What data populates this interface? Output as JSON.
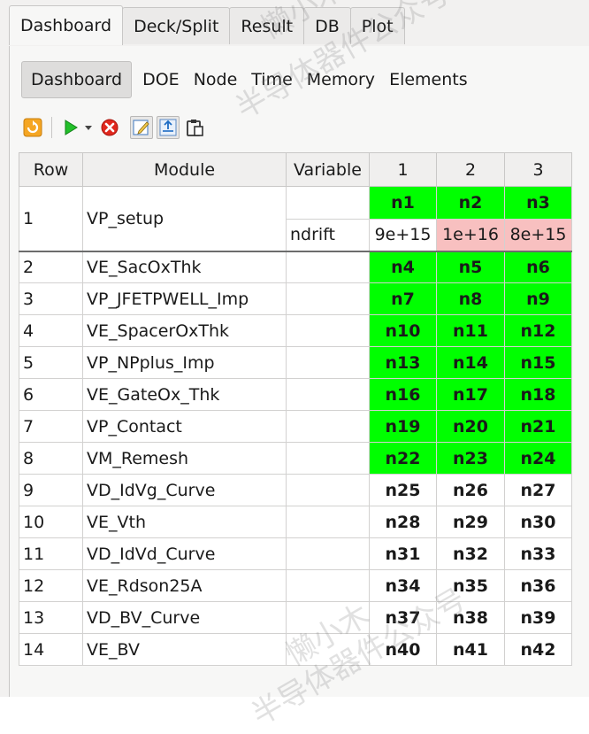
{
  "top_tabs": [
    {
      "label": "Dashboard",
      "active": true
    },
    {
      "label": "Deck/Split",
      "active": false
    },
    {
      "label": "Result",
      "active": false
    },
    {
      "label": "DB",
      "active": false
    },
    {
      "label": "Plot",
      "active": false
    }
  ],
  "sub_tabs": [
    {
      "label": "Dashboard",
      "active": true
    },
    {
      "label": "DOE"
    },
    {
      "label": "Node"
    },
    {
      "label": "Time"
    },
    {
      "label": "Memory"
    },
    {
      "label": "Elements"
    }
  ],
  "toolbar": {
    "icons": [
      "refresh-icon",
      "run-icon",
      "dropdown-arrow-icon",
      "stop-icon",
      "edit-icon",
      "export-icon",
      "clipboard-icon"
    ]
  },
  "table": {
    "headers": [
      "Row",
      "Module",
      "Variable",
      "1",
      "2",
      "3"
    ],
    "row1": {
      "row": "1",
      "module": "VP_setup",
      "sub": [
        {
          "variable": "",
          "values": [
            "n1",
            "n2",
            "n3"
          ]
        },
        {
          "variable": "ndrift",
          "values": [
            "9e+15",
            "1e+16",
            "8e+15"
          ]
        }
      ]
    },
    "rows": [
      {
        "row": "2",
        "module": "VE_SacOxThk",
        "variable": "",
        "values": [
          "n4",
          "n5",
          "n6"
        ],
        "green": true
      },
      {
        "row": "3",
        "module": "VP_JFETPWELL_Imp",
        "variable": "",
        "values": [
          "n7",
          "n8",
          "n9"
        ],
        "green": true
      },
      {
        "row": "4",
        "module": "VE_SpacerOxThk",
        "variable": "",
        "values": [
          "n10",
          "n11",
          "n12"
        ],
        "green": true
      },
      {
        "row": "5",
        "module": "VP_NPplus_Imp",
        "variable": "",
        "values": [
          "n13",
          "n14",
          "n15"
        ],
        "green": true
      },
      {
        "row": "6",
        "module": "VE_GateOx_Thk",
        "variable": "",
        "values": [
          "n16",
          "n17",
          "n18"
        ],
        "green": true
      },
      {
        "row": "7",
        "module": "VP_Contact",
        "variable": "",
        "values": [
          "n19",
          "n20",
          "n21"
        ],
        "green": true
      },
      {
        "row": "8",
        "module": "VM_Remesh",
        "variable": "",
        "values": [
          "n22",
          "n23",
          "n24"
        ],
        "green": true
      },
      {
        "row": "9",
        "module": "VD_IdVg_Curve",
        "variable": "",
        "values": [
          "n25",
          "n26",
          "n27"
        ],
        "green": false
      },
      {
        "row": "10",
        "module": "VE_Vth",
        "variable": "",
        "values": [
          "n28",
          "n29",
          "n30"
        ],
        "green": false
      },
      {
        "row": "11",
        "module": "VD_IdVd_Curve",
        "variable": "",
        "values": [
          "n31",
          "n32",
          "n33"
        ],
        "green": false
      },
      {
        "row": "12",
        "module": "VE_Rdson25A",
        "variable": "",
        "values": [
          "n34",
          "n35",
          "n36"
        ],
        "green": false
      },
      {
        "row": "13",
        "module": "VD_BV_Curve",
        "variable": "",
        "values": [
          "n37",
          "n38",
          "n39"
        ],
        "green": false
      },
      {
        "row": "14",
        "module": "VE_BV",
        "variable": "",
        "values": [
          "n40",
          "n41",
          "n42"
        ],
        "green": false
      }
    ]
  },
  "watermark": {
    "line1": "懒小木",
    "line2": "半导体器件公众号"
  },
  "colors": {
    "green_cell": "#00ff00",
    "pink_cell": "#f8c0c0"
  }
}
